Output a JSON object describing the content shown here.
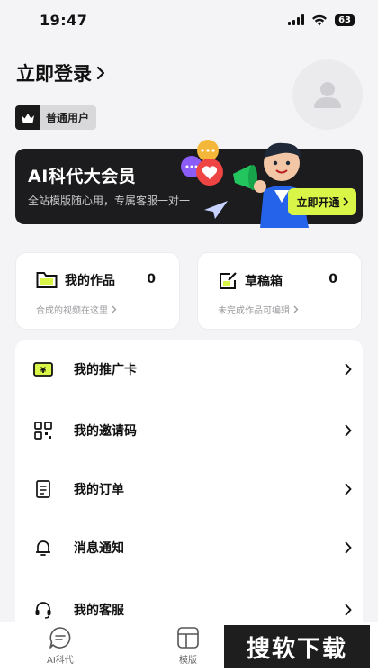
{
  "status_bar": {
    "time": "19:47",
    "battery": "63"
  },
  "profile": {
    "login_label": "立即登录",
    "badge_label": "普通用户"
  },
  "vip_banner": {
    "title": "AI科代大会员",
    "subtitle": "全站模版随心用，专属客服一对一",
    "button_label": "立即开通"
  },
  "cards": [
    {
      "title": "我的作品",
      "count": "0",
      "subtitle": "合成的视频在这里"
    },
    {
      "title": "草稿箱",
      "count": "0",
      "subtitle": "未完成作品可编辑"
    }
  ],
  "menu": {
    "items": [
      {
        "label": "我的推广卡",
        "icon": "promo-card-icon"
      },
      {
        "label": "我的邀请码",
        "icon": "qr-code-icon"
      },
      {
        "label": "我的订单",
        "icon": "order-icon"
      },
      {
        "label": "消息通知",
        "icon": "bell-icon"
      },
      {
        "label": "我的客服",
        "icon": "headset-icon"
      }
    ]
  },
  "tabbar": {
    "tabs": [
      {
        "label": "AI科代",
        "icon": "ai-chat-icon"
      },
      {
        "label": "模版",
        "icon": "template-icon"
      }
    ]
  },
  "watermark": "搜软下载",
  "colors": {
    "accent": "#d8f548",
    "dark": "#1c1c1e",
    "background": "#f4f4f6"
  }
}
